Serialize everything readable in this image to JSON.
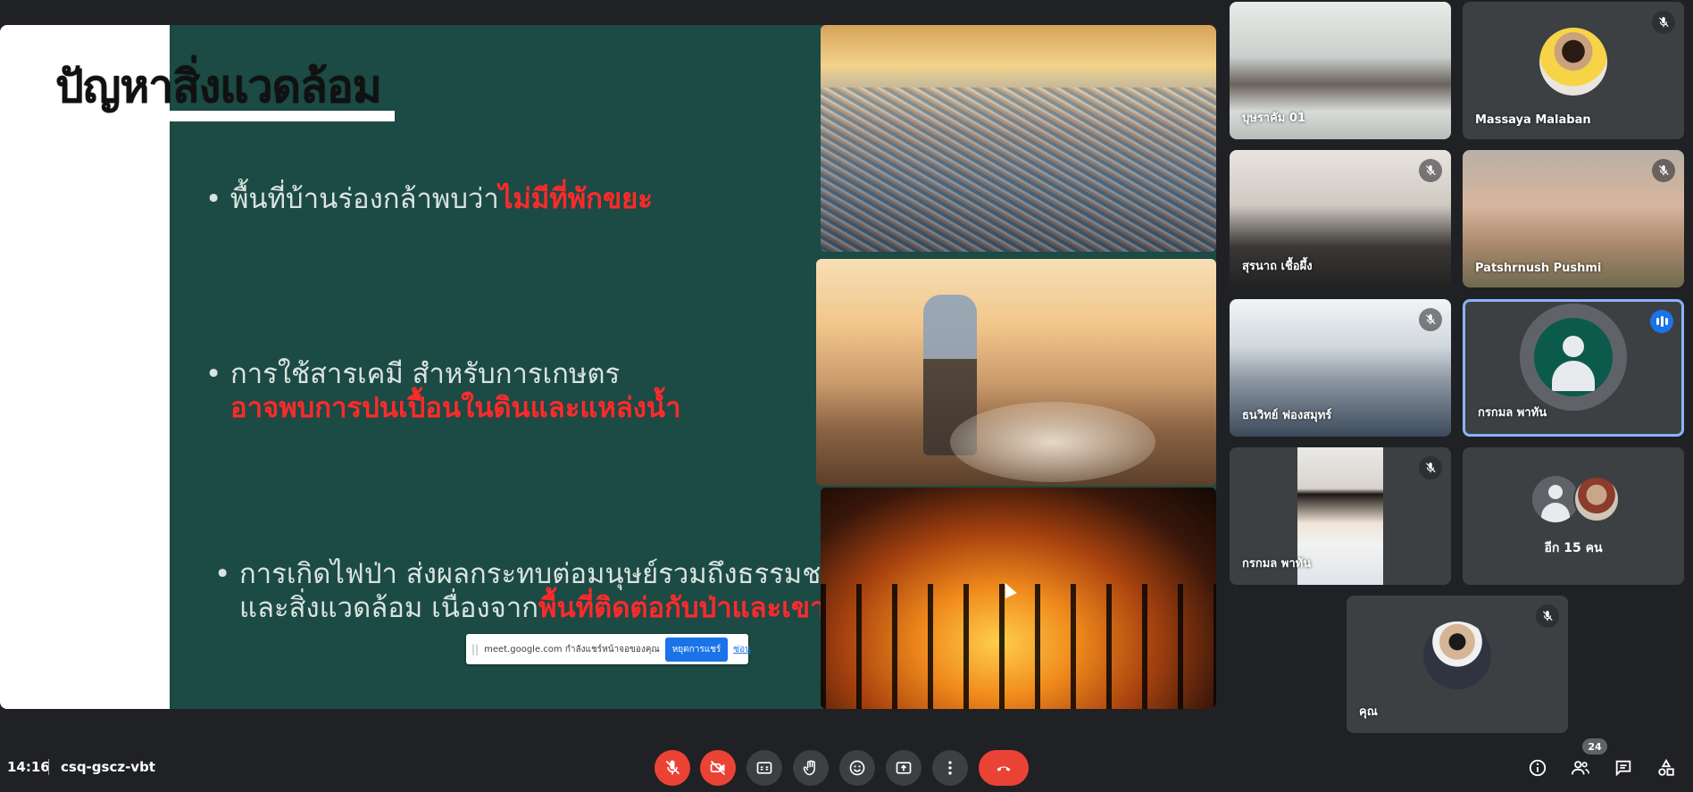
{
  "slide": {
    "title": "ปัญหาสิ่งแวดล้อม",
    "bullets": [
      {
        "text": "พื้นที่บ้านร่องกล้าพบว่า",
        "highlight": "ไม่มีที่พักขยะ"
      },
      {
        "line1": "การใช้สารเคมี สำหรับการเกษตร",
        "highlight": "อาจพบการปนเปื้อนในดินและแหล่งน้ำ"
      },
      {
        "line1": "การเกิดไฟป่า ส่งผลกระทบต่อมนุษย์รวมถึงธรรมชาติ",
        "line2": "และสิ่งแวดล้อม  เนื่องจาก",
        "highlight": "พื้นที่ติดต่อกับป่าและเขา"
      }
    ],
    "bullet_glyph": "•",
    "highlight_color": "#ff2a2a"
  },
  "share_banner": {
    "message": "meet.google.com กำลังแชร์หน้าจอของคุณ",
    "stop_label": "หยุดการแชร์",
    "hide_label": "ซ่อน"
  },
  "participants": [
    {
      "name": "บุษราคัม 01",
      "muted": false
    },
    {
      "name": "Massaya Malaban",
      "muted": true
    },
    {
      "name": "สุรนาถ เชื้อผึ้ง",
      "muted": true
    },
    {
      "name": "Patshrnush Pushmi",
      "muted": true
    },
    {
      "name": "ธนวิทย์ ฟองสมุทร์",
      "muted": true
    },
    {
      "name": "กรกมล พาทัน",
      "muted": false,
      "speaking": true
    },
    {
      "name": "กรกมล พาทัน",
      "muted": true
    },
    {
      "name": "อีก 15 คน",
      "muted": false
    },
    {
      "name": "คุณ",
      "muted": true
    }
  ],
  "bottom_bar": {
    "time": "14:16",
    "meeting_code": "csq-gscz-vbt",
    "people_count": "24",
    "controls": [
      "mic-off-icon",
      "camera-off-icon",
      "captions-icon",
      "raise-hand-icon",
      "emoji-icon",
      "present-icon",
      "more-icon",
      "hang-up-icon"
    ],
    "right_icons": [
      "info-icon",
      "people-icon",
      "chat-icon",
      "activities-icon"
    ]
  },
  "colors": {
    "background": "#202124",
    "tile": "#3c4043",
    "danger": "#ea4335",
    "accent": "#1a73e8",
    "active_border": "#8ab4f8"
  }
}
